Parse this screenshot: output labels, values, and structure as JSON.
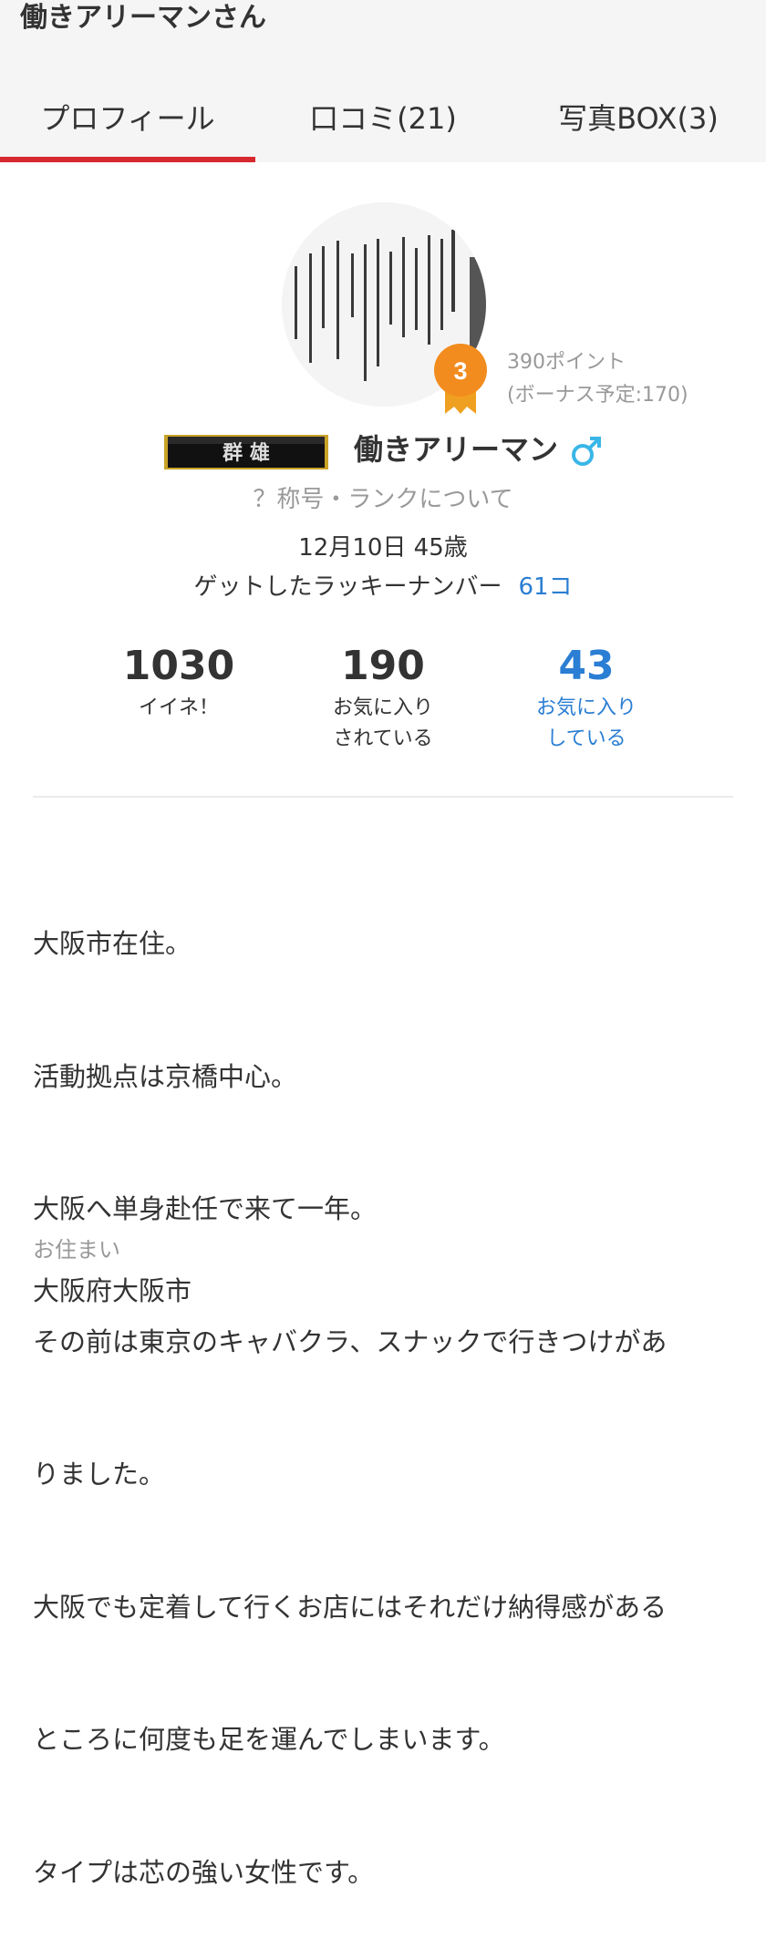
{
  "header": {
    "title": "働きアリーマンさん",
    "tabs": [
      {
        "label": "プロフィール",
        "active": true
      },
      {
        "label": "口コミ(21)",
        "active": false
      },
      {
        "label": "写真BOX(3)",
        "active": false
      }
    ],
    "accent_color": "#d7282f"
  },
  "profile": {
    "rank_level": "3",
    "points": "390ポイント",
    "bonus": "(ボーナス予定:170)",
    "title_plate_text": "群 雄",
    "nickname": "働きアリーマン",
    "gender_icon": "male-symbol-icon",
    "rank_about_link": "？称号・ランクについて",
    "birthday_age": "12月10日 45歳",
    "lucky_label": "ゲットしたラッキーナンバー",
    "lucky_count": "61コ",
    "link_color": "#2a7ed3"
  },
  "stats": [
    {
      "value": "1030",
      "label1": "イイネ！",
      "label2": ""
    },
    {
      "value": "190",
      "label1": "お気に入り",
      "label2": "されている"
    },
    {
      "value": "43",
      "label1": "お気に入り",
      "label2": "している"
    }
  ],
  "bio": {
    "lines": [
      "大阪市在住。",
      "活動拠点は京橋中心。",
      "大阪へ単身赴任で来て一年。",
      "その前は東京のキャバクラ、スナックで行きつけがあ",
      "りました。",
      "大阪でも定着して行くお店にはそれだけ納得感がある",
      "ところに何度も足を運んでしまいます。",
      "タイプは芯の強い女性です。"
    ]
  },
  "residence": {
    "label": "お住まい",
    "value": "大阪府大阪市"
  }
}
